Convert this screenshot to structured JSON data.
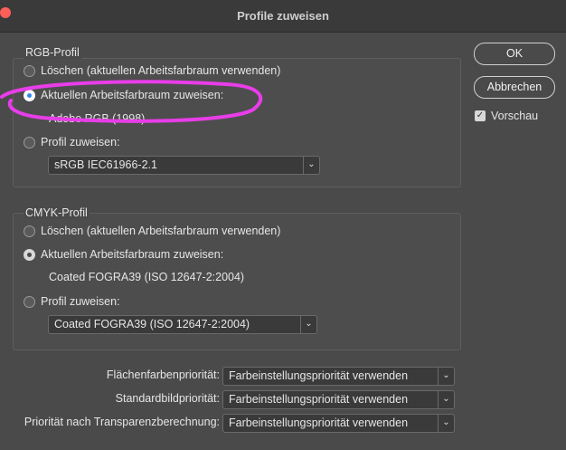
{
  "title": "Profile zuweisen",
  "buttons": {
    "ok": "OK",
    "cancel": "Abbrechen"
  },
  "preview": {
    "label": "Vorschau",
    "checked": true
  },
  "rgb": {
    "title": "RGB-Profil",
    "discard": "Löschen (aktuellen Arbeitsfarbraum verwenden)",
    "assign_current": "Aktuellen Arbeitsfarbraum zuweisen:",
    "current_profile": "Adobe RGB (1998)",
    "assign_profile": "Profil zuweisen:",
    "profile_select": "sRGB IEC61966-2.1",
    "selected": "assign_current"
  },
  "cmyk": {
    "title": "CMYK-Profil",
    "discard": "Löschen (aktuellen Arbeitsfarbraum verwenden)",
    "assign_current": "Aktuellen Arbeitsfarbraum zuweisen:",
    "current_profile": "Coated FOGRA39 (ISO 12647-2:2004)",
    "assign_profile": "Profil zuweisen:",
    "profile_select": "Coated FOGRA39 (ISO 12647-2:2004)",
    "selected": "assign_current"
  },
  "priorities": [
    {
      "label": "Flächenfarbenpriorität:",
      "value": "Farbeinstellungspriorität verwenden"
    },
    {
      "label": "Standardbildpriorität:",
      "value": "Farbeinstellungspriorität verwenden"
    },
    {
      "label": "Priorität nach Transparenzberechnung:",
      "value": "Farbeinstellungspriorität verwenden"
    }
  ],
  "colors": {
    "annotation_highlight": "#e83de8",
    "radio_selected": "#2d8cf0"
  }
}
